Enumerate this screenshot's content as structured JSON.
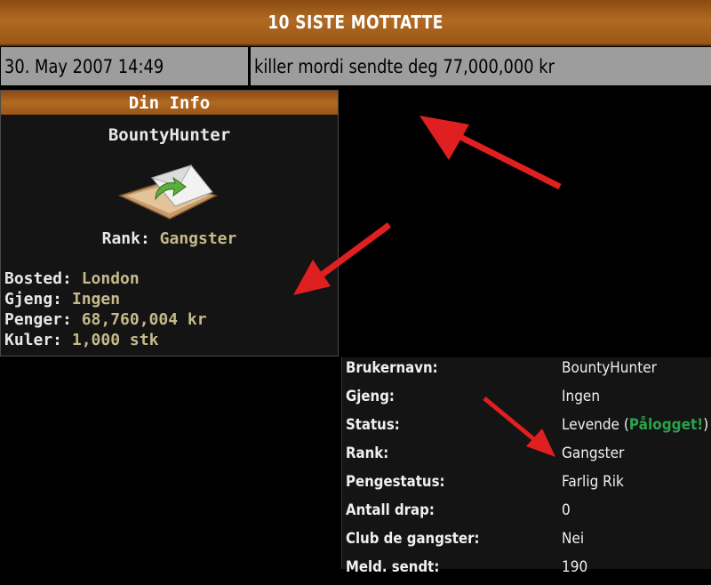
{
  "header": {
    "title": "10 SISTE MOTTATTE"
  },
  "message": {
    "date": "30. May 2007 14:49",
    "text": "killer mordi sendte deg 77,000,000 kr"
  },
  "info_box": {
    "title": "Din Info",
    "username": "BountyHunter",
    "rank_label": "Rank:",
    "rank_value": "Gangster",
    "items": [
      {
        "label": "Bosted:",
        "value": "London"
      },
      {
        "label": "Gjeng:",
        "value": "Ingen"
      },
      {
        "label": "Penger:",
        "value": "68,760,004 kr"
      },
      {
        "label": "Kuler:",
        "value": "1,000 stk"
      }
    ]
  },
  "profile": {
    "rows": [
      {
        "label": "Brukernavn:",
        "value": "BountyHunter"
      },
      {
        "label": "Gjeng:",
        "value": "Ingen"
      },
      {
        "label": "Status:",
        "value": "Levende",
        "paren_open": " (",
        "online": "Pålogget!",
        "paren_close": ")"
      },
      {
        "label": "Rank:",
        "value": "Gangster"
      },
      {
        "label": "Pengestatus:",
        "value": "Farlig Rik"
      },
      {
        "label": "Antall drap:",
        "value": "0"
      },
      {
        "label": "Club de gangster:",
        "value": "Nei"
      },
      {
        "label": "Meld. sendt:",
        "value": "190"
      }
    ]
  },
  "colors": {
    "header_brown": "#b06a22",
    "message_gray": "#9d9d9d",
    "gold_value": "#c6b98a",
    "online_green": "#2aa24a",
    "arrow_red": "#e02020"
  },
  "icons": {
    "envelope": "envelope-arrow-icon"
  }
}
